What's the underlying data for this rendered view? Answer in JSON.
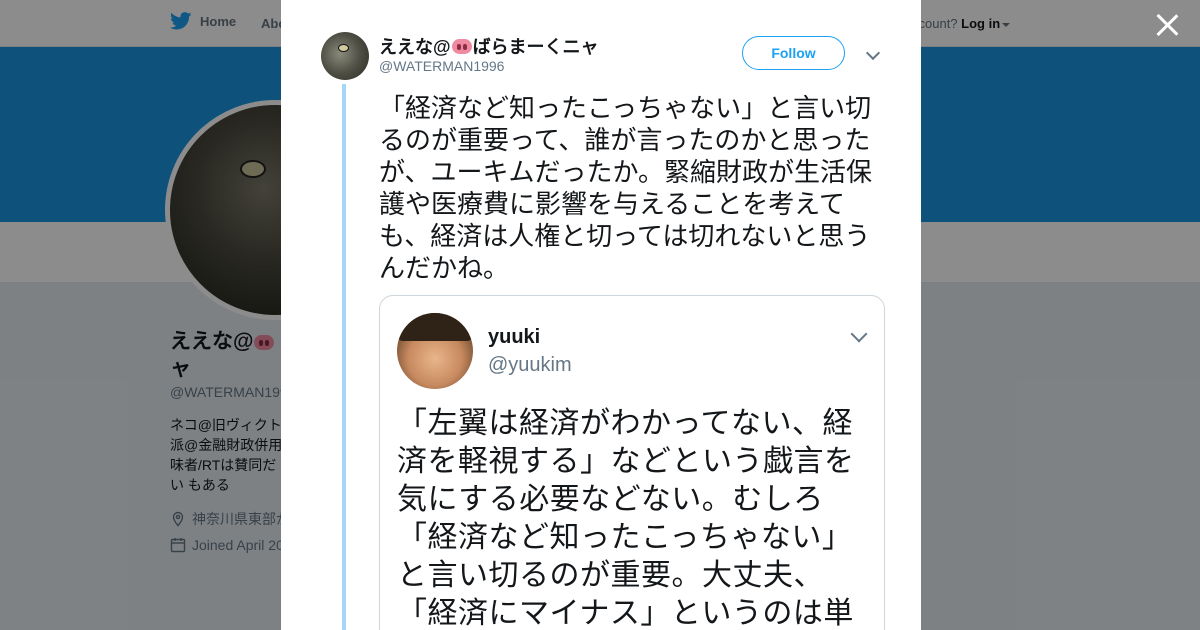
{
  "background": {
    "nav": {
      "home_label": "Home",
      "about_label": "Abo",
      "login_prefix": "ccount?",
      "login_label": "Log in"
    },
    "profile": {
      "name_prefix": "ええな@",
      "name_suffix": "ャ",
      "handle": "@WATERMAN199",
      "bio": "ネコ@旧ヴィクト 派@金融財政併用 味者/RTは賛同だい もある",
      "location": "神奈川県東部が",
      "joined": "Joined April 20"
    },
    "colors": {
      "banner": "#1b95e0",
      "accent": "#1da1f2"
    }
  },
  "modal": {
    "author": {
      "name_prefix": "ええな@",
      "name_suffix": "ばらまーくニャ",
      "handle": "@WATERMAN1996",
      "emoji_name": "pig-nose"
    },
    "follow_label": "Follow",
    "tweet_text": "「経済など知ったこっちゃない」と言い切るのが重要って、誰が言ったのかと思ったが、ユーキムだったか。緊縮財政が生活保護や医療費に影響を与えることを考えても、経済は人権と切っては切れないと思うんだかね。",
    "embedded": {
      "name": "yuuki",
      "handle": "@yuukim",
      "text": "「左翼は経済がわかってない、経済を軽視する」などという戯言を気にする必要などない。むしろ「経済など知ったこっちゃない」と言い切るのが重要。大丈夫、「経済にマイナス」というのは単"
    }
  }
}
